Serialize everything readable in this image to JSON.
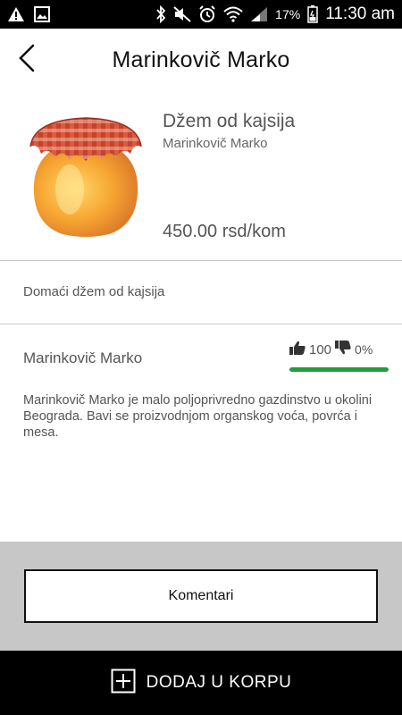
{
  "status_bar": {
    "battery_percent": "17%",
    "time": "11:30 am",
    "icons": [
      "warning-icon",
      "image-icon",
      "bluetooth-icon",
      "mute-icon",
      "alarm-icon",
      "wifi-icon",
      "signal-icon",
      "battery-icon"
    ]
  },
  "header": {
    "title": "Marinkovič Marko",
    "back_icon": "chevron-left-icon"
  },
  "product": {
    "name": "Džem od kajsija",
    "producer": "Marinkovič Marko",
    "price": "450.00 rsd/kom",
    "image": "jam-jar-image"
  },
  "description": {
    "text": "Domaći džem od kajsija"
  },
  "producer_info": {
    "name": "Marinkovič Marko",
    "likes": "100",
    "dislikes": "0%",
    "rating_fraction": 1.0,
    "rating_color": "#1f9e3c",
    "about": "Marinkovič Marko je malo poljoprivredno gazdinstvo u okolini Beograda. Bavi se proizvodnjom organskog voća, povrća i mesa."
  },
  "comments": {
    "button_label": "Komentari"
  },
  "cart": {
    "button_label": "DODAJ U KORPU",
    "icon": "plus-square-icon"
  },
  "colors": {
    "status_bar": "#000000",
    "comments_background": "#c7c7c7",
    "cart_bar": "#000000"
  }
}
